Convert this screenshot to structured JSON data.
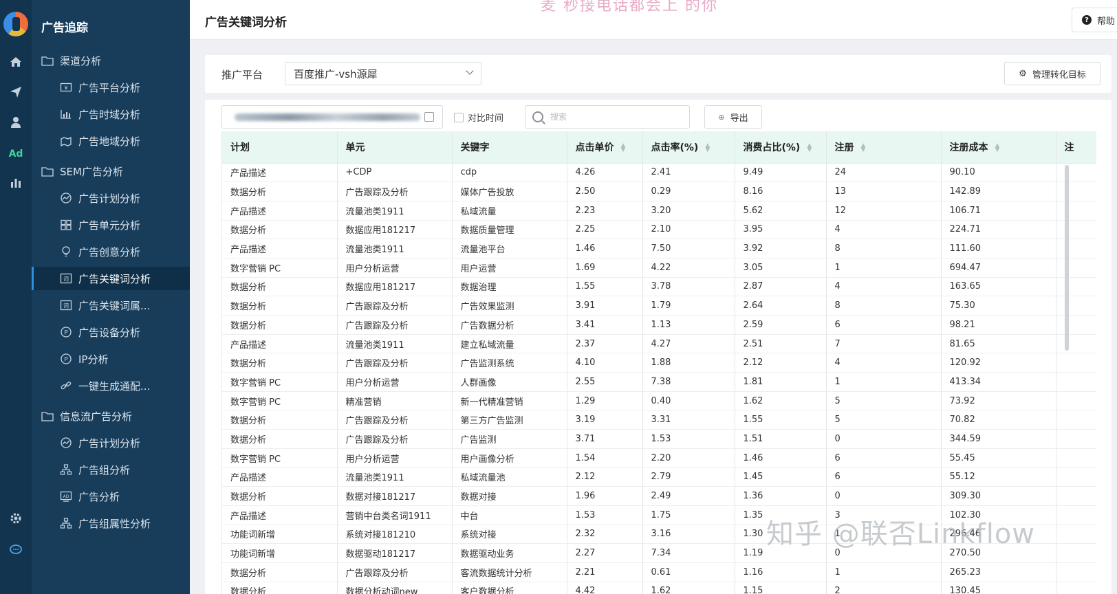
{
  "app": {
    "title": "广告追踪"
  },
  "rail_icons": [
    "home-icon",
    "send-icon",
    "user-icon",
    "ad-icon",
    "bar-chart-icon",
    "gear-icon",
    "chat-icon"
  ],
  "rail_ad_label": "Ad",
  "sidebar": {
    "items": [
      {
        "label": "渠道分析",
        "type": "group",
        "icon": "folder-icon"
      },
      {
        "label": "广告平台分析",
        "type": "child",
        "icon": "money-icon"
      },
      {
        "label": "广告时域分析",
        "type": "child",
        "icon": "bar-chart-icon"
      },
      {
        "label": "广告地域分析",
        "type": "child",
        "icon": "map-icon"
      },
      {
        "label": "SEM广告分析",
        "type": "group",
        "icon": "folder-icon"
      },
      {
        "label": "广告计划分析",
        "type": "child",
        "icon": "trend-icon"
      },
      {
        "label": "广告单元分析",
        "type": "child",
        "icon": "grid-icon"
      },
      {
        "label": "广告创意分析",
        "type": "child",
        "icon": "bulb-icon"
      },
      {
        "label": "广告关键词分析",
        "type": "child",
        "icon": "keyword-icon",
        "active": true
      },
      {
        "label": "广告关键词属...",
        "type": "child",
        "icon": "keyword-icon"
      },
      {
        "label": "广告设备分析",
        "type": "child",
        "icon": "device-icon"
      },
      {
        "label": "IP分析",
        "type": "child",
        "icon": "ip-icon"
      },
      {
        "label": "一键生成通配...",
        "type": "child",
        "icon": "link-icon"
      },
      {
        "label": "信息流广告分析",
        "type": "group",
        "icon": "folder-icon"
      },
      {
        "label": "广告计划分析",
        "type": "child",
        "icon": "trend-icon"
      },
      {
        "label": "广告组分析",
        "type": "child",
        "icon": "org-icon"
      },
      {
        "label": "广告分析",
        "type": "child",
        "icon": "ad-box-icon"
      },
      {
        "label": "广告组属性分析",
        "type": "child",
        "icon": "org-icon"
      }
    ]
  },
  "header": {
    "title": "广告关键词分析",
    "overlay_text": "麦  秒接电话都会上  的你",
    "help_label": "帮助"
  },
  "filters": {
    "platform_label": "推广平台",
    "platform_value": "百度推广-vsh源犀",
    "manage_label": "管理转化目标",
    "compare_label": "对比时间",
    "search_placeholder": "搜索",
    "export_label": "导出"
  },
  "table": {
    "columns": [
      "计划",
      "单元",
      "关键字",
      "点击单价",
      "点击率(%)",
      "消费占比(%)",
      "注册",
      "注册成本",
      "注"
    ],
    "sortable": [
      false,
      false,
      false,
      true,
      true,
      true,
      true,
      true,
      false
    ],
    "rows": [
      [
        "产品描述",
        "+CDP",
        "cdp",
        "4.26",
        "2.41",
        "9.49",
        "24",
        "90.10"
      ],
      [
        "数据分析",
        "广告跟踪及分析",
        "媒体广告投放",
        "2.50",
        "0.29",
        "8.16",
        "13",
        "142.89"
      ],
      [
        "产品描述",
        "流量池类1911",
        "私域流量",
        "2.23",
        "3.20",
        "5.62",
        "12",
        "106.71"
      ],
      [
        "数据分析",
        "数据应用181217",
        "数据质量管理",
        "2.25",
        "2.10",
        "3.95",
        "4",
        "224.71"
      ],
      [
        "产品描述",
        "流量池类1911",
        "流量池平台",
        "1.46",
        "7.50",
        "3.92",
        "8",
        "111.60"
      ],
      [
        "数字营销 PC",
        "用户分析运营",
        "用户运营",
        "1.69",
        "4.22",
        "3.05",
        "1",
        "694.47"
      ],
      [
        "数据分析",
        "数据应用181217",
        "数据治理",
        "1.55",
        "3.78",
        "2.87",
        "4",
        "163.65"
      ],
      [
        "数据分析",
        "广告跟踪及分析",
        "广告效果监测",
        "3.91",
        "1.79",
        "2.64",
        "8",
        "75.30"
      ],
      [
        "数据分析",
        "广告跟踪及分析",
        "广告数据分析",
        "3.41",
        "1.13",
        "2.59",
        "6",
        "98.21"
      ],
      [
        "产品描述",
        "流量池类1911",
        "建立私域流量",
        "2.37",
        "4.27",
        "2.51",
        "7",
        "81.65"
      ],
      [
        "数据分析",
        "广告跟踪及分析",
        "广告监测系统",
        "4.10",
        "1.88",
        "2.12",
        "4",
        "120.92"
      ],
      [
        "数字营销 PC",
        "用户分析运营",
        "人群画像",
        "2.55",
        "7.38",
        "1.81",
        "1",
        "413.34"
      ],
      [
        "数字营销 PC",
        "精准营销",
        "新一代精准营销",
        "1.29",
        "0.40",
        "1.62",
        "5",
        "73.92"
      ],
      [
        "数据分析",
        "广告跟踪及分析",
        "第三方广告监测",
        "3.19",
        "3.31",
        "1.55",
        "5",
        "70.82"
      ],
      [
        "数据分析",
        "广告跟踪及分析",
        "广告监测",
        "3.71",
        "1.53",
        "1.51",
        "0",
        "344.59"
      ],
      [
        "数字营销 PC",
        "用户分析运营",
        "用户画像分析",
        "1.54",
        "2.20",
        "1.46",
        "6",
        "55.45"
      ],
      [
        "产品描述",
        "流量池类1911",
        "私域流量池",
        "2.12",
        "2.79",
        "1.45",
        "6",
        "55.12"
      ],
      [
        "数据分析",
        "数据对接181217",
        "数据对接",
        "1.96",
        "2.49",
        "1.36",
        "0",
        "309.30"
      ],
      [
        "产品描述",
        "营销中台类名词1911",
        "中台",
        "1.53",
        "1.75",
        "1.35",
        "3",
        "102.30"
      ],
      [
        "功能词新增",
        "系统对接181210",
        "系统对接",
        "2.32",
        "3.16",
        "1.30",
        "1",
        "296.46"
      ],
      [
        "功能词新增",
        "数据驱动181217",
        "数据驱动业务",
        "2.27",
        "7.34",
        "1.19",
        "0",
        "270.50"
      ],
      [
        "数据分析",
        "广告跟踪及分析",
        "客流数据统计分析",
        "2.21",
        "0.61",
        "1.16",
        "1",
        "265.23"
      ],
      [
        "数据分析",
        "数据分析动词new",
        "客户数据分析",
        "4.42",
        "1.62",
        "1.15",
        "2",
        "130.45"
      ]
    ]
  },
  "watermark": "知乎 @联否Linkflow"
}
